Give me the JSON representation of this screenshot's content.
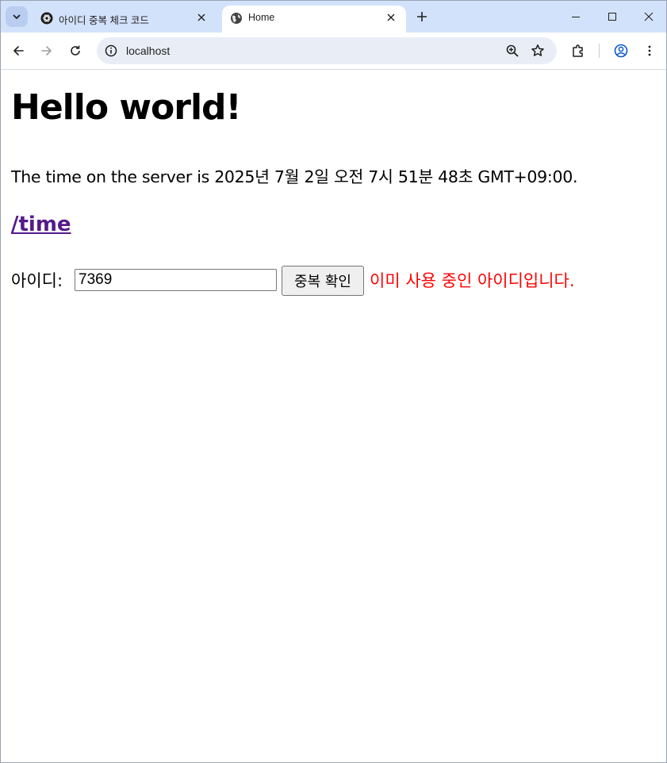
{
  "browser": {
    "tabs": [
      {
        "title": "아이디 중복 체크 코드",
        "favicon": "chatgpt-logo-icon",
        "active": false
      },
      {
        "title": "Home",
        "favicon": "globe-icon",
        "active": true
      }
    ],
    "address_bar": {
      "url": "localhost"
    }
  },
  "page": {
    "heading": "Hello world!",
    "server_time_text": "The time on the server is 2025년 7월 2일 오전 7시 51분 48초 GMT+09:00.",
    "time_link_text": "/time",
    "id_form": {
      "label": "아이디:",
      "input_value": "7369",
      "button_label": "중복 확인",
      "result_message": "이미 사용 중인 아이디입니다.",
      "result_color": "#ff0000"
    }
  },
  "colors": {
    "tabstrip_bg": "#d3e2fb",
    "visited_link": "#551a8b",
    "omnibox_bg": "#e9eef6"
  }
}
